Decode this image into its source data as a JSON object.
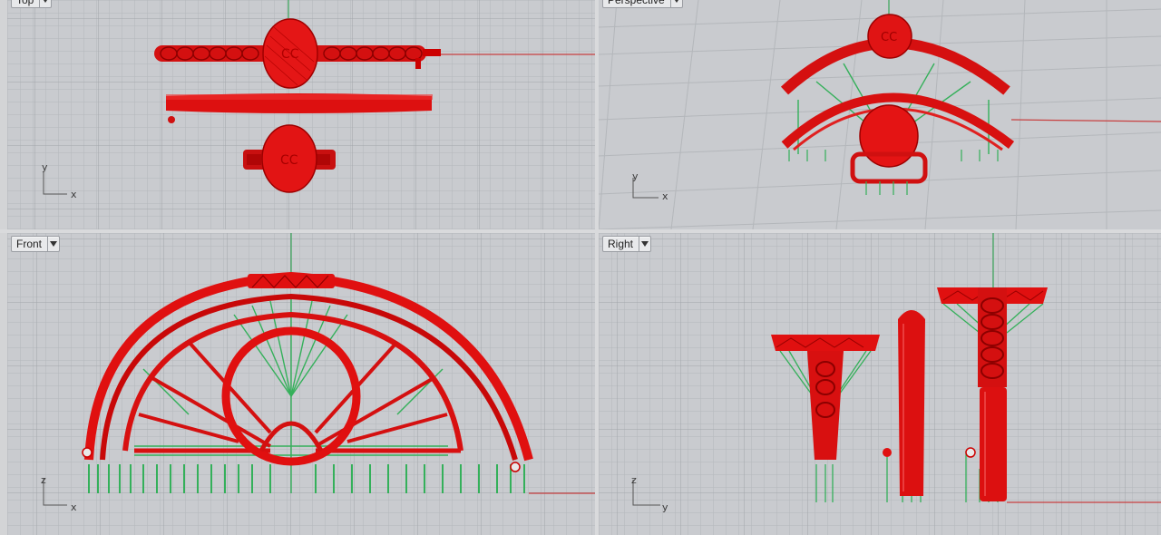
{
  "viewports": [
    {
      "id": "top",
      "label": "Top",
      "axis_h": "x",
      "axis_v": "y"
    },
    {
      "id": "perspective",
      "label": "Perspective",
      "axis_h": "x",
      "axis_v": "y"
    },
    {
      "id": "front",
      "label": "Front",
      "axis_h": "x",
      "axis_v": "z"
    },
    {
      "id": "right",
      "label": "Right",
      "axis_h": "y",
      "axis_v": "z"
    }
  ],
  "colors": {
    "grid_bg": "#c9cbcf",
    "grid_line": "#b4b7bb",
    "grid_major": "#a1a5aa",
    "model": "#e01010",
    "supports": "#34b05a",
    "x_axis": "#c84040",
    "y_axis": "#3aa55a"
  },
  "icons": {
    "dropdown": "triangle-down-icon"
  }
}
